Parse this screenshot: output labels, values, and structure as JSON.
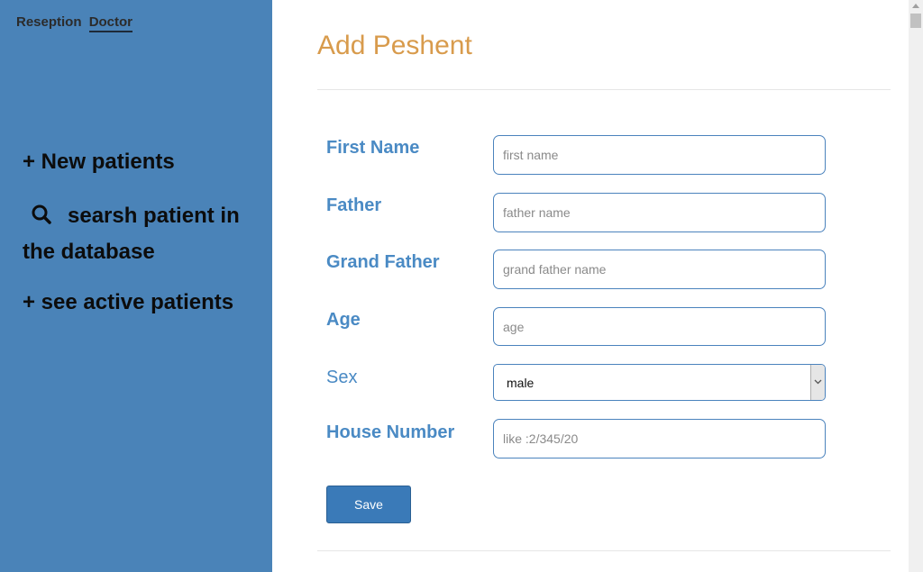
{
  "nav": {
    "tabs": [
      {
        "label": "Reseption",
        "active": false
      },
      {
        "label": "Doctor",
        "active": true
      }
    ]
  },
  "sidebar": {
    "new_patients": "+ New patients",
    "search_patient": "searsh patient in the database",
    "active_patients": "+ see active patients",
    "icons": {
      "search": "search-icon"
    }
  },
  "form": {
    "title": "Add Peshent",
    "fields": [
      {
        "label": "First Name",
        "placeholder": "first name",
        "value": ""
      },
      {
        "label": "Father",
        "placeholder": "father name",
        "value": ""
      },
      {
        "label": "Grand Father",
        "placeholder": "grand father name",
        "value": ""
      },
      {
        "label": "Age",
        "placeholder": "age",
        "value": ""
      },
      {
        "label": "House Number",
        "placeholder": "like :2/345/20",
        "value": ""
      }
    ],
    "sex": {
      "label": "Sex",
      "selected": "male"
    },
    "save_label": "Save"
  },
  "colors": {
    "sidebar_bg": "#4a83b8",
    "title": "#d89b4c",
    "label": "#4a8ac4",
    "button": "#3a7ab8"
  }
}
